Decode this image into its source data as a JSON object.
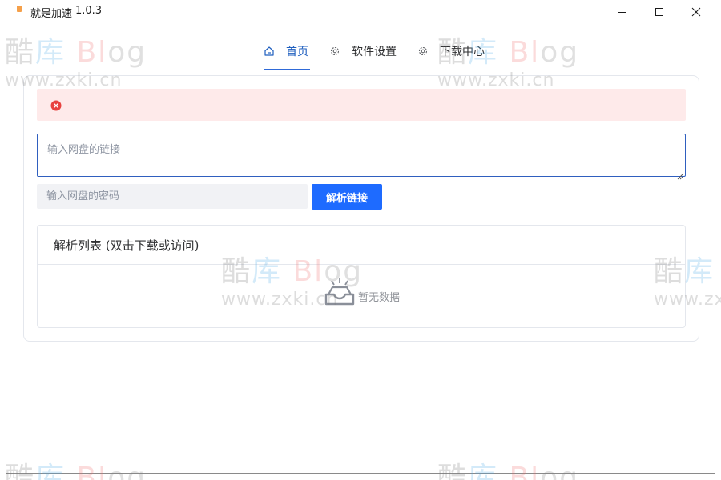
{
  "window": {
    "title": "就是加速",
    "version": "1.0.3"
  },
  "nav": {
    "tabs": [
      {
        "label": "首页",
        "icon": "home-icon",
        "active": true
      },
      {
        "label": "软件设置",
        "icon": "gear-icon",
        "active": false
      },
      {
        "label": "下载中心",
        "icon": "gear-icon",
        "active": false
      }
    ]
  },
  "form": {
    "url_placeholder": "输入网盘的链接",
    "url_value": "",
    "password_placeholder": "输入网盘的密码",
    "password_value": "",
    "parse_button": "解析链接"
  },
  "list": {
    "title": "解析列表 (双击下载或访问)",
    "empty_text": "暂无数据"
  },
  "watermark": {
    "logo_part1": "酷",
    "logo_part2": "库",
    "logo_part3": "Bl",
    "logo_part4": "og",
    "url": "www.zxki.cn"
  },
  "colors": {
    "accent": "#1e6bff",
    "active_tab": "#1f5fbf",
    "alert_bg": "#feeaea",
    "error_icon": "#e8423f"
  }
}
